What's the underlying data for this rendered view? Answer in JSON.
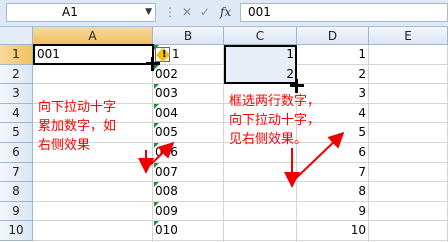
{
  "formula_bar": {
    "name_box": "A1",
    "name_box_dropdown_icon": "dropdown-arrow",
    "fx_label": "fx",
    "formula_value": "001"
  },
  "columns": [
    "A",
    "B",
    "C",
    "D",
    "E"
  ],
  "rows": [
    "1",
    "2",
    "3",
    "4",
    "5",
    "6",
    "7",
    "8",
    "9",
    "10"
  ],
  "cells": {
    "A1": "001",
    "B": [
      "001",
      "002",
      "003",
      "004",
      "005",
      "006",
      "007",
      "008",
      "009",
      "010"
    ],
    "C": [
      "1",
      "2"
    ],
    "D": [
      "1",
      "2",
      "3",
      "4",
      "5",
      "6",
      "7",
      "8",
      "9",
      "10"
    ]
  },
  "annotations": {
    "left": [
      "向下拉动十字",
      "累加数字，如",
      "右侧效果"
    ],
    "right": [
      "框选两行数字，",
      "向下拉动十字，",
      "见右侧效果。"
    ]
  },
  "colors": {
    "annotation": "#ff0000",
    "selected_header": "#f1c15f",
    "error_indicator": "#1e8f3a"
  }
}
